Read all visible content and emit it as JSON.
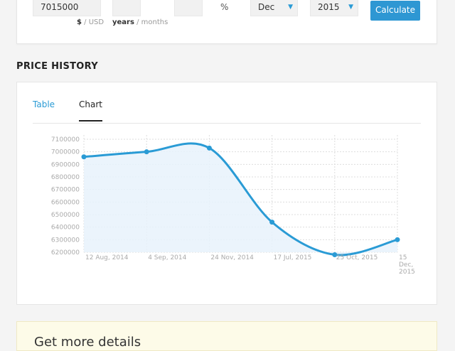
{
  "calculator": {
    "price_value": "7015000",
    "price_unit_selected": "$",
    "price_unit_other": "USD",
    "duration_unit_selected": "years",
    "duration_unit_other": "months",
    "percent_symbol": "%",
    "month_value": "Dec",
    "year_value": "2015",
    "calculate_label": "Calculate"
  },
  "price_history": {
    "title": "PRICE HISTORY",
    "tabs": [
      {
        "label": "Table",
        "active": false
      },
      {
        "label": "Chart",
        "active": true
      }
    ]
  },
  "chart_data": {
    "type": "area",
    "x": [
      "12 Aug, 2014",
      "4 Sep, 2014",
      "24 Nov, 2014",
      "17 Jul, 2015",
      "25 Oct, 2015",
      "15 Dec, 2015"
    ],
    "x_tick_lines": [
      [
        "12 Aug, 2014"
      ],
      [
        "4 Sep, 2014"
      ],
      [
        "24 Nov, 2014"
      ],
      [
        "17 Jul, 2015"
      ],
      [
        "25 Oct, 2015"
      ],
      [
        "15",
        "Dec,",
        "2015"
      ]
    ],
    "series": [
      {
        "values": [
          6960000,
          7000000,
          7030000,
          6440000,
          6180000,
          6300000
        ]
      }
    ],
    "y_ticks": [
      6200000,
      6300000,
      6400000,
      6500000,
      6600000,
      6700000,
      6800000,
      6900000,
      7000000,
      7100000
    ],
    "ylim": [
      6200000,
      7100000
    ],
    "grid": true,
    "colors": {
      "line": "#2a9bd5",
      "fill": "#e8f2fb",
      "grid": "#dddddd"
    }
  },
  "promo": {
    "text": "Get more details"
  }
}
